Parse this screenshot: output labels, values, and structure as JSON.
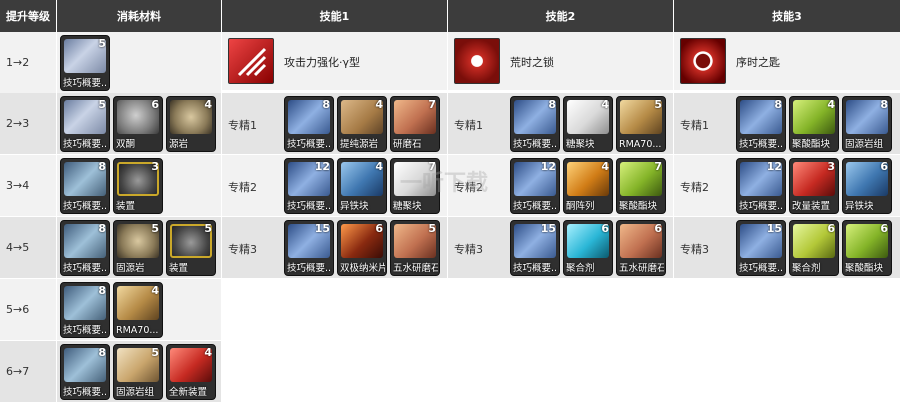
{
  "headers": {
    "level": "提升等级",
    "materials": "消耗材料",
    "skill1": "技能1",
    "skill2": "技能2",
    "skill3": "技能3"
  },
  "skills": [
    {
      "name": "攻击力强化·γ型"
    },
    {
      "name": "荒时之锁"
    },
    {
      "name": "序时之匙"
    }
  ],
  "levels": [
    {
      "label": "1→2",
      "materials": [
        {
          "name": "技巧概要...",
          "count": "5",
          "icon": "book"
        }
      ]
    },
    {
      "label": "2→3",
      "materials": [
        {
          "name": "技巧概要...",
          "count": "5",
          "icon": "book"
        },
        {
          "name": "双酮",
          "count": "6",
          "icon": "stone"
        },
        {
          "name": "源岩",
          "count": "4",
          "icon": "rock"
        }
      ]
    },
    {
      "label": "3→4",
      "materials": [
        {
          "name": "技巧概要...",
          "count": "8",
          "icon": "book2"
        },
        {
          "name": "装置",
          "count": "3",
          "icon": "device"
        }
      ]
    },
    {
      "label": "4→5",
      "materials": [
        {
          "name": "技巧概要...",
          "count": "8",
          "icon": "book2"
        },
        {
          "name": "固源岩",
          "count": "5",
          "icon": "rock"
        },
        {
          "name": "装置",
          "count": "5",
          "icon": "device"
        }
      ]
    },
    {
      "label": "5→6",
      "materials": [
        {
          "name": "技巧概要...",
          "count": "8",
          "icon": "book2"
        },
        {
          "name": "RMA70...",
          "count": "4",
          "icon": "gold"
        }
      ]
    },
    {
      "label": "6→7",
      "materials": [
        {
          "name": "技巧概要...",
          "count": "8",
          "icon": "book2"
        },
        {
          "name": "固源岩组",
          "count": "5",
          "icon": "orirock"
        },
        {
          "name": "全新装置",
          "count": "4",
          "icon": "red"
        }
      ]
    }
  ],
  "elites": {
    "labels": [
      "专精1",
      "专精2",
      "专精3"
    ],
    "skill1": [
      [
        {
          "name": "技巧概要...",
          "count": "8",
          "icon": "book3"
        },
        {
          "name": "提纯源岩",
          "count": "4",
          "icon": "cube"
        },
        {
          "name": "研磨石",
          "count": "7",
          "icon": "whet"
        }
      ],
      [
        {
          "name": "技巧概要...",
          "count": "12",
          "icon": "book3"
        },
        {
          "name": "异铁块",
          "count": "4",
          "icon": "iron"
        },
        {
          "name": "糖聚块",
          "count": "7",
          "icon": "sugar"
        }
      ],
      [
        {
          "name": "技巧概要...",
          "count": "15",
          "icon": "book3"
        },
        {
          "name": "双极纳米片",
          "count": "6",
          "icon": "lava"
        },
        {
          "name": "五水研磨石",
          "count": "5",
          "icon": "whet"
        }
      ]
    ],
    "skill2": [
      [
        {
          "name": "技巧概要...",
          "count": "8",
          "icon": "book3"
        },
        {
          "name": "糖聚块",
          "count": "4",
          "icon": "sugar"
        },
        {
          "name": "RMA70...",
          "count": "5",
          "icon": "gold"
        }
      ],
      [
        {
          "name": "技巧概要...",
          "count": "12",
          "icon": "book3"
        },
        {
          "name": "酮阵列",
          "count": "4",
          "icon": "amber"
        },
        {
          "name": "聚酸酯块",
          "count": "7",
          "icon": "green"
        }
      ],
      [
        {
          "name": "技巧概要...",
          "count": "15",
          "icon": "book3"
        },
        {
          "name": "聚合剂",
          "count": "6",
          "icon": "cyan"
        },
        {
          "name": "五水研磨石",
          "count": "6",
          "icon": "whet"
        }
      ]
    ],
    "skill3": [
      [
        {
          "name": "技巧概要...",
          "count": "8",
          "icon": "book3"
        },
        {
          "name": "聚酸酯块",
          "count": "4",
          "icon": "green"
        },
        {
          "name": "固源岩组",
          "count": "8",
          "icon": "book3"
        }
      ],
      [
        {
          "name": "技巧概要...",
          "count": "12",
          "icon": "book3"
        },
        {
          "name": "改量装置",
          "count": "3",
          "icon": "red"
        },
        {
          "name": "异铁块",
          "count": "6",
          "icon": "iron"
        }
      ],
      [
        {
          "name": "技巧概要...",
          "count": "15",
          "icon": "book3"
        },
        {
          "name": "聚合剂",
          "count": "6",
          "icon": "gel"
        },
        {
          "name": "聚酸酯块",
          "count": "6",
          "icon": "green"
        }
      ]
    ]
  },
  "watermark": "一听下载",
  "colors": {
    "header": "#3c3c3c",
    "row_light": "#f2f2f2",
    "row_dark": "#e4e4e4",
    "skill_red": "#c62a22"
  }
}
